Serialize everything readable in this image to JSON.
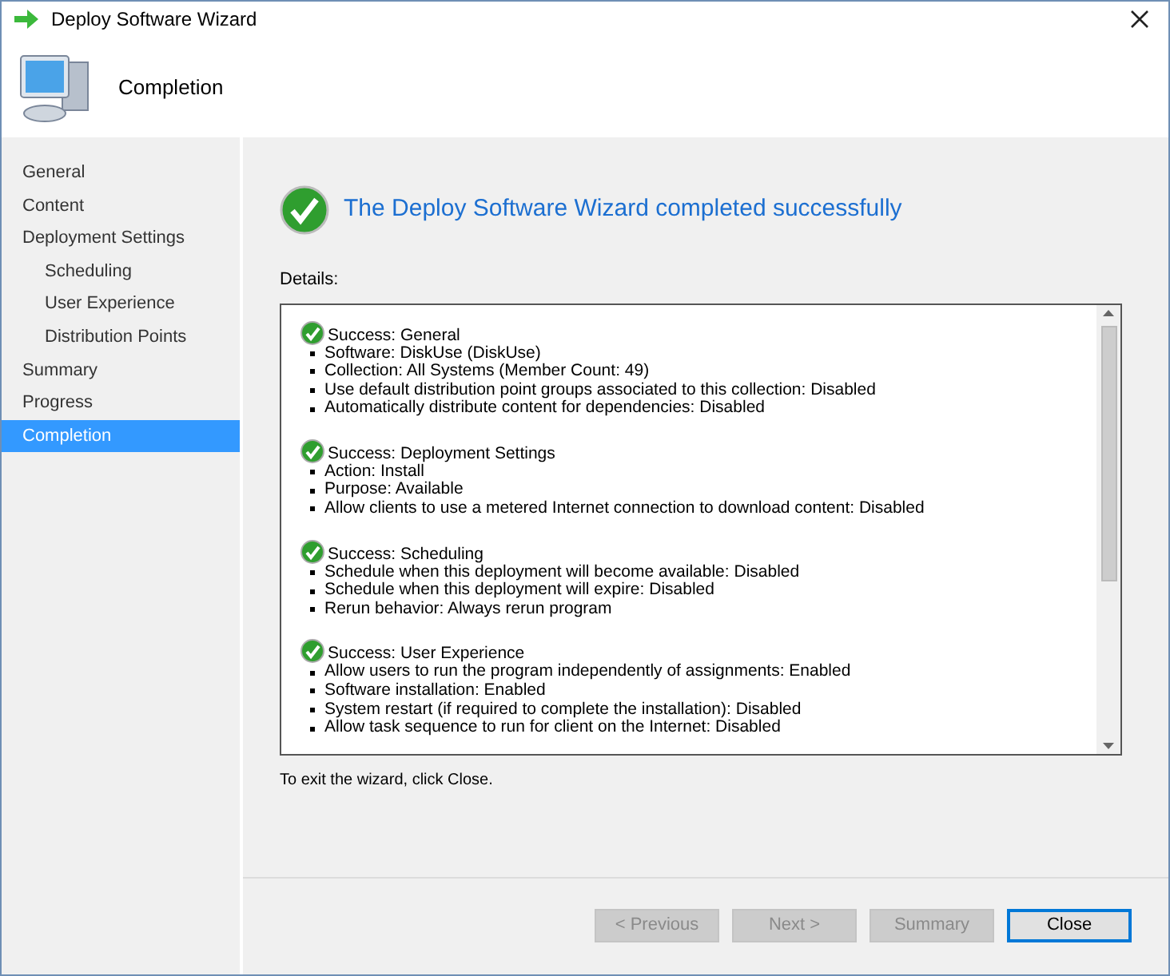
{
  "window": {
    "title": "Deploy Software Wizard"
  },
  "header": {
    "title": "Completion"
  },
  "sidebar": {
    "items": [
      {
        "label": "General",
        "selected": false
      },
      {
        "label": "Content",
        "selected": false
      },
      {
        "label": "Deployment Settings",
        "selected": false,
        "children": [
          {
            "label": "Scheduling",
            "selected": false
          },
          {
            "label": "User Experience",
            "selected": false
          },
          {
            "label": "Distribution Points",
            "selected": false
          }
        ]
      },
      {
        "label": "Summary",
        "selected": false
      },
      {
        "label": "Progress",
        "selected": false
      },
      {
        "label": "Completion",
        "selected": true
      }
    ]
  },
  "result": {
    "heading": "The Deploy Software Wizard completed successfully"
  },
  "details": {
    "label": "Details:",
    "sections": [
      {
        "title": "Success: General",
        "items": [
          "Software: DiskUse (DiskUse)",
          "Collection: All Systems (Member Count: 49)",
          "Use default distribution point groups associated to this collection: Disabled",
          "Automatically distribute content for dependencies: Disabled"
        ]
      },
      {
        "title": "Success: Deployment Settings",
        "items": [
          "Action: Install",
          "Purpose: Available",
          "Allow clients to use a metered Internet connection to download content: Disabled"
        ]
      },
      {
        "title": "Success: Scheduling",
        "items": [
          "Schedule when this deployment will become available: Disabled",
          "Schedule when this deployment will expire: Disabled",
          "Rerun behavior: Always rerun program"
        ]
      },
      {
        "title": "Success: User Experience",
        "items": [
          "Allow users to run the program independently of assignments: Enabled",
          "Software installation: Enabled",
          "System restart (if required to complete the installation): Disabled",
          "Allow task sequence to run for client on the Internet: Disabled"
        ]
      }
    ]
  },
  "hint": "To exit the wizard, click Close.",
  "buttons": [
    {
      "label": "< Previous",
      "disabled": true,
      "focused": false
    },
    {
      "label": "Next >",
      "disabled": true,
      "focused": false
    },
    {
      "label": "Summary",
      "disabled": true,
      "focused": false
    },
    {
      "label": "Close",
      "disabled": false,
      "focused": true
    }
  ]
}
